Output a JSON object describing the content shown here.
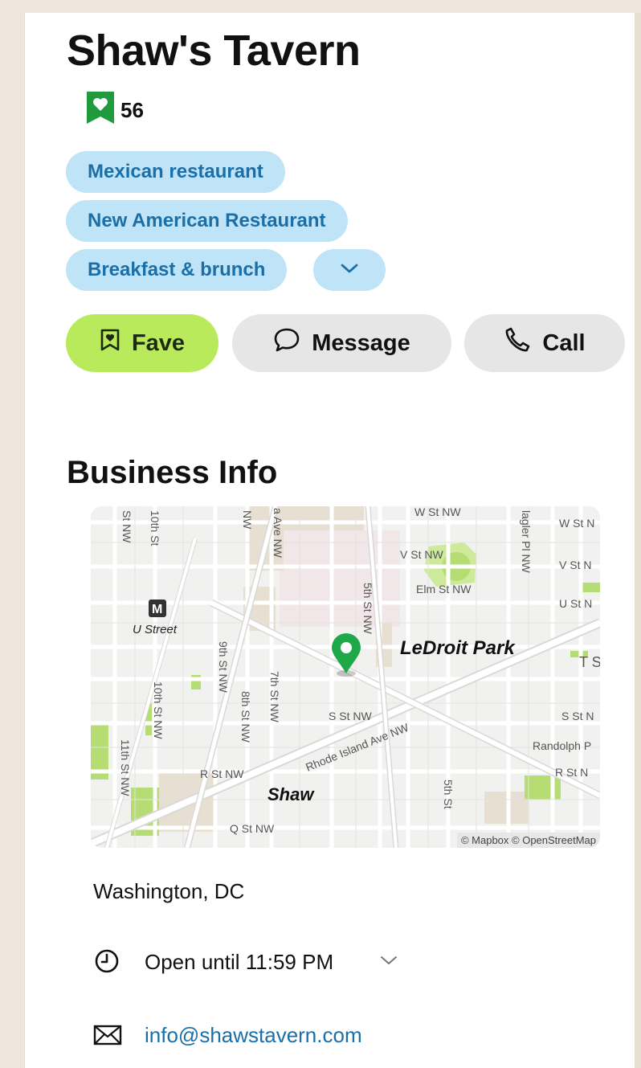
{
  "business": {
    "name": "Shaw's Tavern",
    "faves_count": "56"
  },
  "categories": [
    "Mexican restaurant",
    "New American Restaurant",
    "Breakfast & brunch"
  ],
  "actions": {
    "fave": "Fave",
    "message": "Message",
    "call": "Call"
  },
  "section_title": "Business Info",
  "map": {
    "labels": {
      "ledroit_park": "LeDroit Park",
      "shaw": "Shaw",
      "u_street": "U Street",
      "rhode_island": "Rhode Island Ave NW",
      "elm_st": "Elm St NW",
      "v_st": "V St NW",
      "w_st_top": "W St NW",
      "w_st_right": "W St N",
      "v_st_right": "V St N",
      "u_st_right": "U St N",
      "s_st": "S St NW",
      "s_st_right": "S St N",
      "r_st": "R St NW",
      "r_st_right": "R St N",
      "q_st": "Q St NW",
      "randolph": "Randolph P",
      "t_st": "T S",
      "fifth_st": "5th St NW",
      "ninth_st": "9th St NW",
      "eighth_st": "8th St NW",
      "seventh_st": "7th St NW",
      "tenth_st": "10th St NW",
      "eleventh_st": "11th St NW",
      "ga_ave": "a Ave NW",
      "st_nw_top": "St NW",
      "tenth_top": "10th St",
      "nw_top": "NW",
      "flagler": "lagler Pl NW",
      "fifth_bottom": "5th St",
      "metro": "M"
    },
    "attribution": "© Mapbox © OpenStreetMap"
  },
  "location": "Washington, DC",
  "hours": "Open until 11:59 PM",
  "email": "info@shawstavern.com",
  "colors": {
    "chip_bg": "#bfe3f7",
    "chip_text": "#1a6fa8",
    "fave_bg": "#b8ea5c",
    "pin": "#1fa84a",
    "heart_badge": "#1f9a3c"
  }
}
